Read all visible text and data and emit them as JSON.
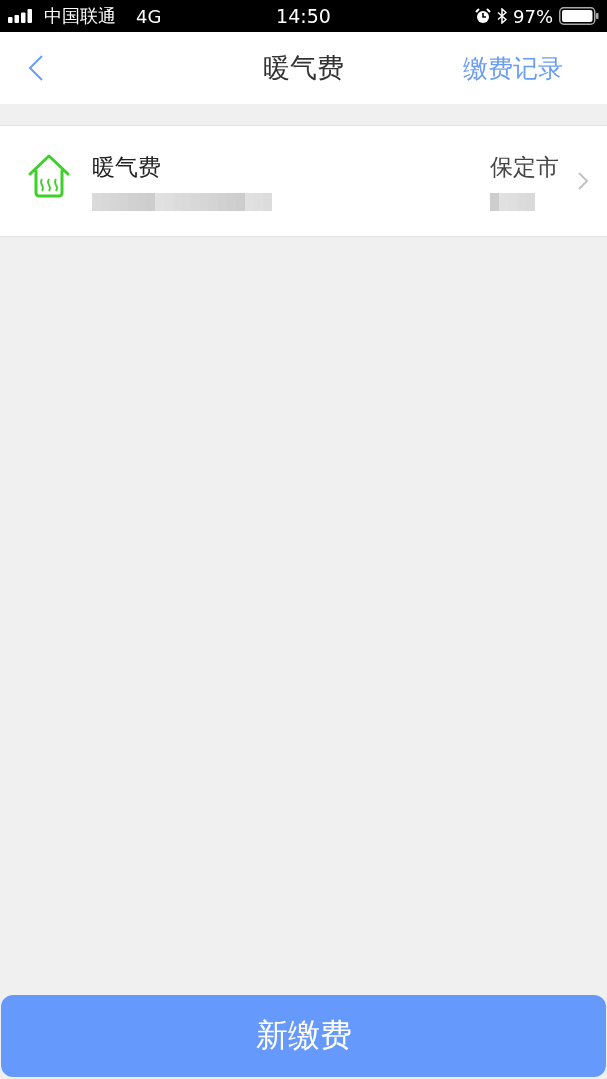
{
  "status_bar": {
    "carrier": "中国联通",
    "network": "4G",
    "time": "14:50",
    "battery": "97%"
  },
  "nav": {
    "title": "暖气费",
    "action": "缴费记录"
  },
  "accounts": [
    {
      "name": "暖气费",
      "city": "保定市"
    }
  ],
  "primary_button": "新缴费"
}
